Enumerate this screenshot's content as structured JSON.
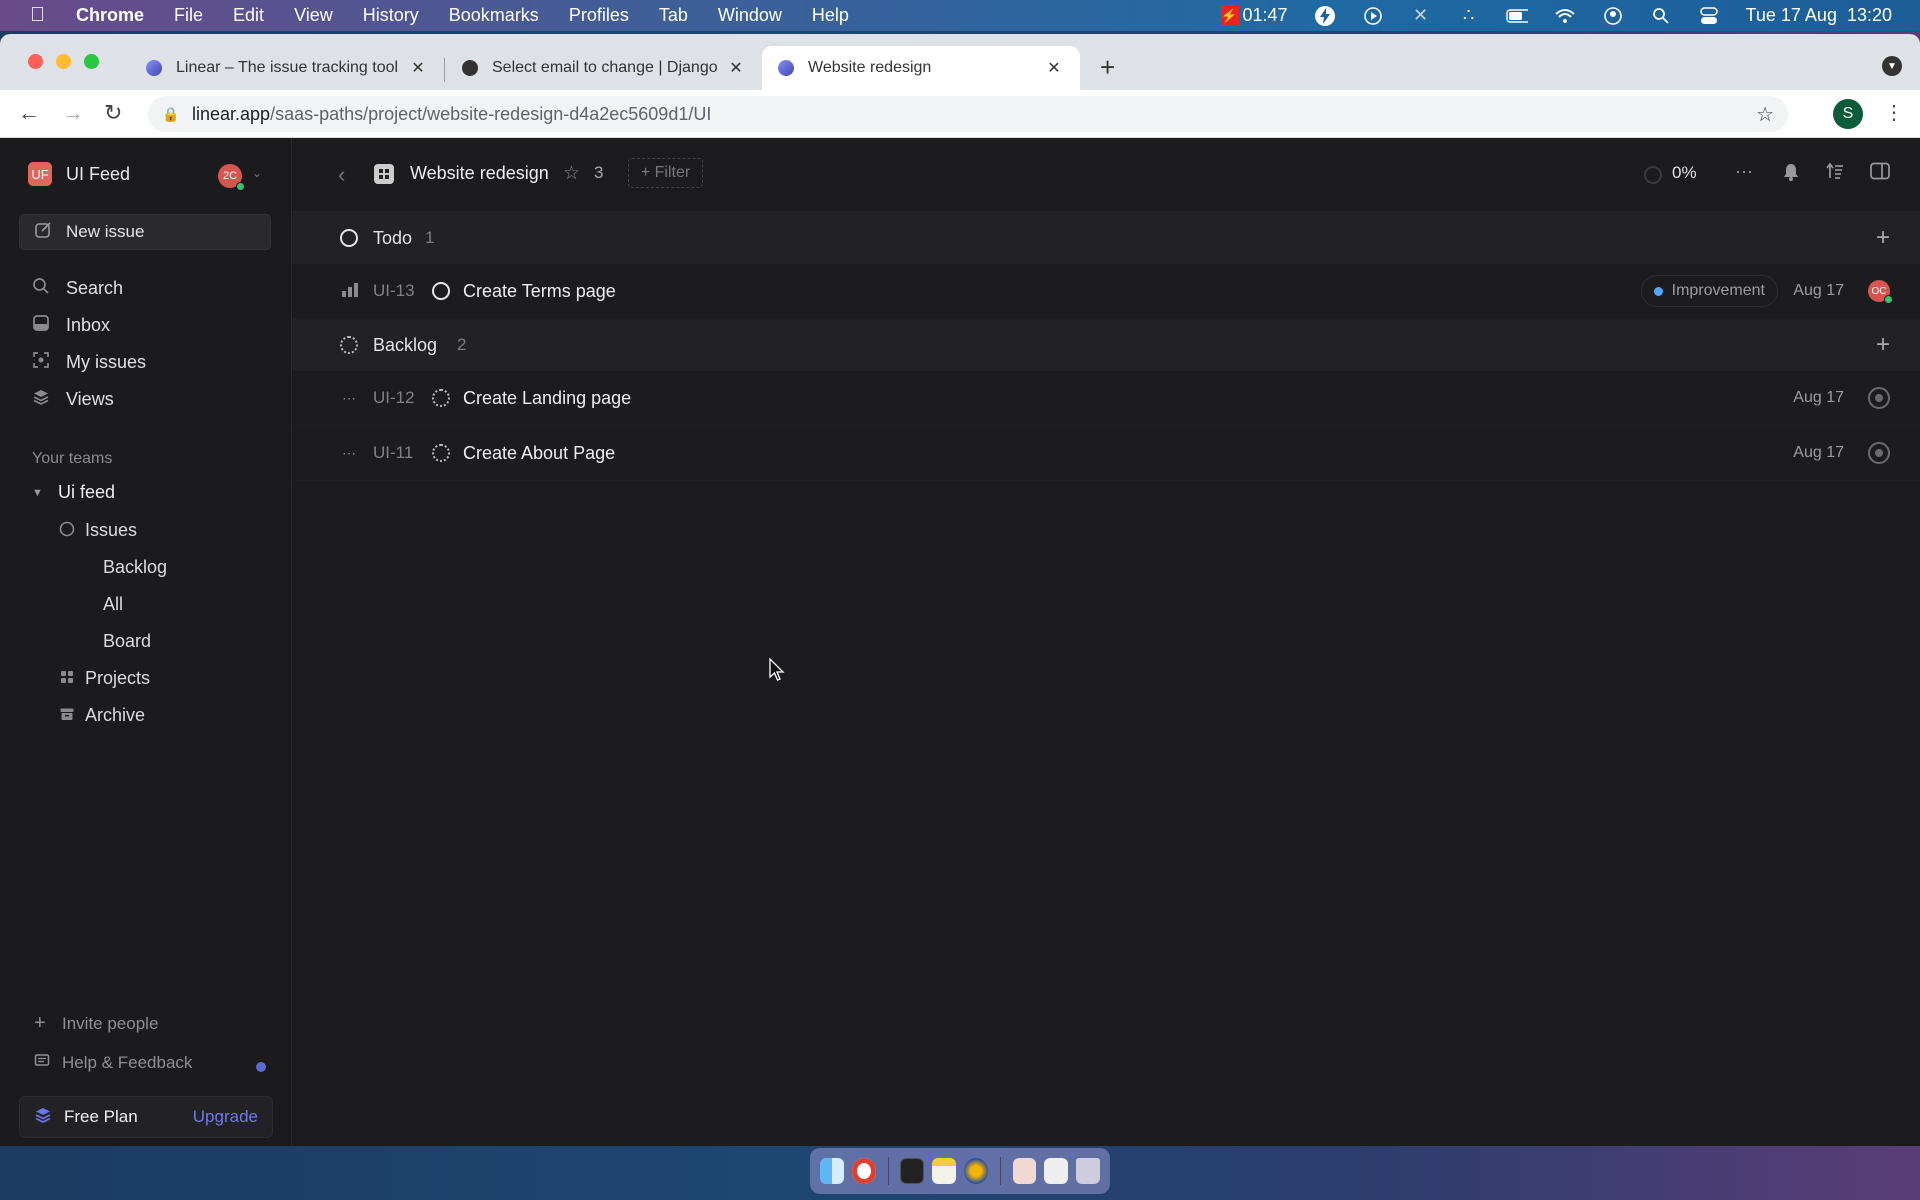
{
  "menubar": {
    "app": "Chrome",
    "items": [
      "File",
      "Edit",
      "View",
      "History",
      "Bookmarks",
      "Profiles",
      "Tab",
      "Window",
      "Help"
    ],
    "recording_time": "01:47",
    "datetime": "Tue 17 Aug  13:20"
  },
  "browser": {
    "tabs": [
      {
        "title": "Linear – The issue tracking tool",
        "active": false
      },
      {
        "title": "Select email to change | Django",
        "active": false
      },
      {
        "title": "Website redesign",
        "active": true
      }
    ],
    "url_host": "linear.app",
    "url_path": "/saas-paths/project/website-redesign-d4a2ec5609d1/UI",
    "profile_initial": "S"
  },
  "sidebar": {
    "workspace": {
      "logo": "UF",
      "name": "UI Feed",
      "avatar": "2C"
    },
    "new_issue": "New issue",
    "nav": [
      {
        "label": "Search",
        "icon": "search-icon"
      },
      {
        "label": "Inbox",
        "icon": "inbox-icon"
      },
      {
        "label": "My issues",
        "icon": "my-issues-icon"
      },
      {
        "label": "Views",
        "icon": "layers-icon"
      }
    ],
    "teams_label": "Your teams",
    "team": {
      "name": "Ui feed",
      "items": [
        {
          "label": "Issues"
        },
        {
          "label": "Backlog"
        },
        {
          "label": "All"
        },
        {
          "label": "Board"
        },
        {
          "label": "Projects"
        },
        {
          "label": "Archive"
        }
      ]
    },
    "invite": "Invite people",
    "help": "Help & Feedback",
    "plan": {
      "label": "Free Plan",
      "upgrade": "Upgrade"
    }
  },
  "project": {
    "title": "Website redesign",
    "star_count": "3",
    "filter": "+ Filter",
    "progress": "0%"
  },
  "groups": [
    {
      "name": "Todo",
      "count": "1",
      "issues": [
        {
          "id": "UI-13",
          "title": "Create Terms page",
          "label": "Improvement",
          "label_color": "#4ea7fc",
          "date": "Aug 17",
          "assignee": "OC"
        }
      ]
    },
    {
      "name": "Backlog",
      "count": "2",
      "issues": [
        {
          "id": "UI-12",
          "title": "Create Landing page",
          "date": "Aug 17"
        },
        {
          "id": "UI-11",
          "title": "Create About Page",
          "date": "Aug 17"
        }
      ]
    }
  ],
  "colors": {
    "accent": "#5e6ad2",
    "online": "#35c26a",
    "avatar_red": "#d9534f"
  }
}
